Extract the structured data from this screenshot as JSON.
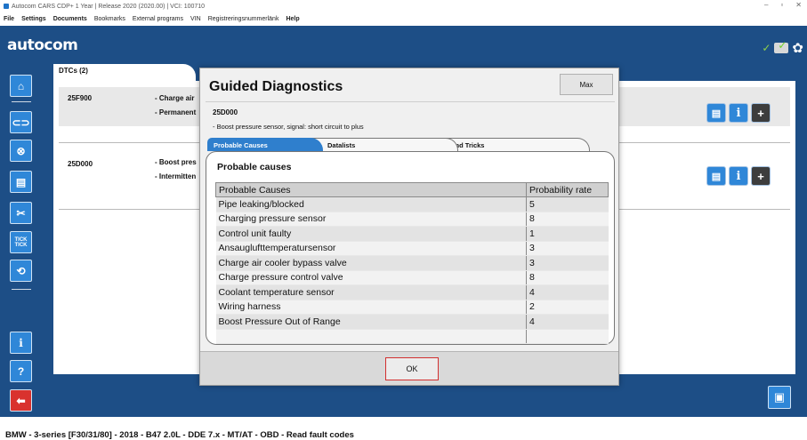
{
  "window": {
    "title": "Autocom CARS CDP+ 1 Year | Release 2020 (2020.00) | VCI: 100710",
    "controls": [
      "–",
      "▫",
      "✕"
    ]
  },
  "menu": {
    "items": [
      "File",
      "Settings",
      "Documents",
      "Bookmarks",
      "External programs",
      "VIN",
      "Registreringsnummerlänk",
      "Help"
    ]
  },
  "header": {
    "logo": "autocom"
  },
  "dtc_tab": {
    "label": "DTCs (2)"
  },
  "dtcs": [
    {
      "code": "25F900",
      "line1": "- Charge air",
      "line2": "- Permanent"
    },
    {
      "code": "25D000",
      "line1": "- Boost pres",
      "line2": "- Intermitten"
    }
  ],
  "left_toolbar": {
    "icons": [
      "home-icon",
      "connector-icon",
      "crossed-connector-icon",
      "report-icon",
      "tools-icon",
      "tick-tick-icon",
      "recycle-icon",
      "info-icon",
      "help-icon",
      "back-arrow-icon"
    ],
    "tick_text": "TICK\nTICK"
  },
  "row_buttons": {
    "info": "i",
    "plus": "+"
  },
  "dialog": {
    "title": "Guided Diagnostics",
    "max_label": "Max",
    "code": "25D000",
    "description": "- Boost pressure sensor, signal: short circuit to plus",
    "tabs": [
      "Probable Causes",
      "Datalists",
      "Tips and Tricks"
    ],
    "section_heading": "Probable causes",
    "table": {
      "headers": [
        "Probable Causes",
        "Probability rate"
      ],
      "rows": [
        [
          "Pipe leaking/blocked",
          "5"
        ],
        [
          "Charging pressure sensor",
          "8"
        ],
        [
          "Control unit faulty",
          "1"
        ],
        [
          "Ansauglufttemperatursensor",
          "3"
        ],
        [
          "Charge air cooler bypass valve",
          "3"
        ],
        [
          "Charge pressure control valve",
          "8"
        ],
        [
          "Coolant temperature sensor",
          "4"
        ],
        [
          "Wiring harness",
          "2"
        ],
        [
          "Boost Pressure Out of Range",
          "4"
        ]
      ]
    },
    "ok_label": "OK"
  },
  "status_bar": {
    "text": "BMW - 3-series [F30/31/80] - 2018 - B47 2.0L - DDE 7.x - MT/AT - OBD - Read fault codes"
  },
  "colors": {
    "brand_blue": "#1d4e86",
    "button_blue": "#2f87d8",
    "back_red": "#d9322e",
    "ok_border": "#d23030"
  }
}
